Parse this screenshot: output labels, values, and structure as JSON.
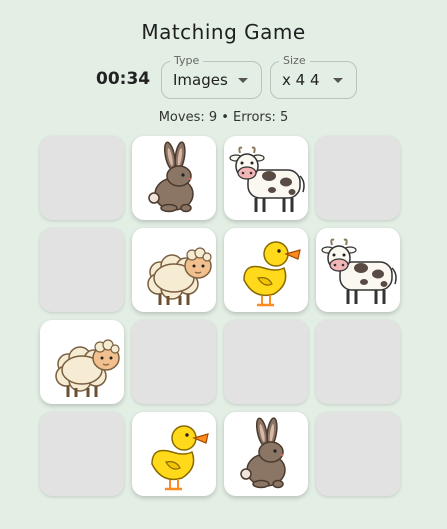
{
  "title": "Matching Game",
  "timer": "00:34",
  "type_select": {
    "legend": "Type",
    "value": "Images"
  },
  "size_select": {
    "legend": "Size",
    "value": "x 4 4"
  },
  "stats": "Moves: 9 • Errors: 5",
  "board": {
    "rows": 4,
    "cols": 4,
    "cards": [
      "hidden",
      "rabbit",
      "cow",
      "hidden",
      "hidden",
      "sheep",
      "duck",
      "cow",
      "sheep",
      "hidden",
      "hidden",
      "hidden",
      "hidden",
      "duck",
      "rabbit",
      "hidden"
    ]
  }
}
